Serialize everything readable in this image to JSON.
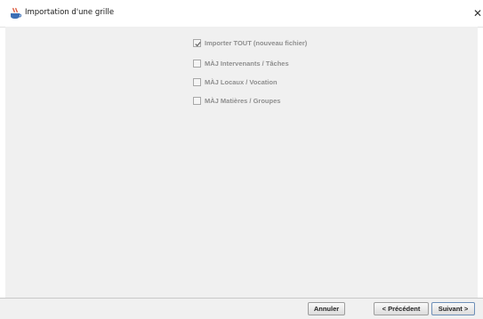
{
  "window": {
    "title": "Importation d'une grille",
    "app_icon": "java-cup-icon",
    "close_glyph": "✕"
  },
  "options": [
    {
      "label": "Importer TOUT (nouveau fichier)",
      "checked": true,
      "enabled": false
    },
    {
      "label": "MÀJ Intervenants / Tâches",
      "checked": false,
      "enabled": false
    },
    {
      "label": "MÀJ Locaux / Vocation",
      "checked": false,
      "enabled": false
    },
    {
      "label": "MÀJ Matières / Groupes",
      "checked": false,
      "enabled": false
    }
  ],
  "buttons": {
    "cancel": "Annuler",
    "previous": "< Précédent",
    "next": "Suivant >"
  }
}
